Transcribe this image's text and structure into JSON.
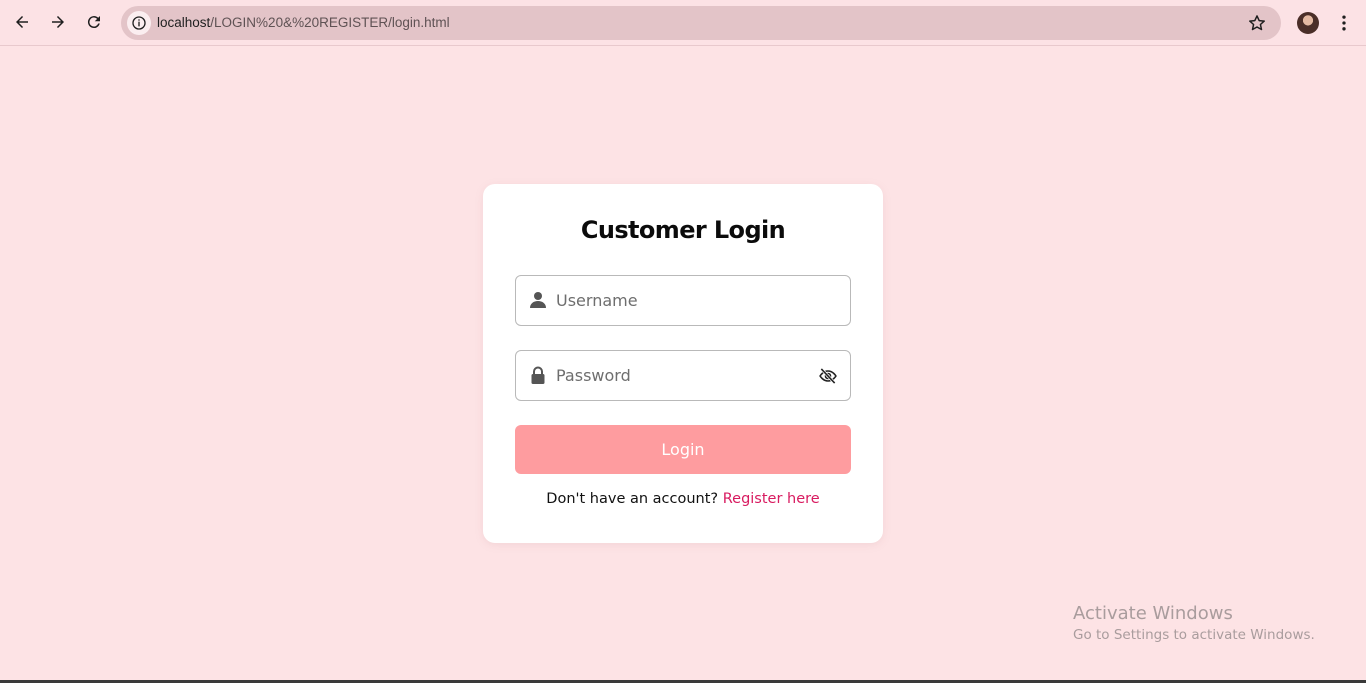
{
  "browser": {
    "url_host": "localhost",
    "url_path": "/LOGIN%20&%20REGISTER/login.html",
    "icons": [
      "back-arrow-icon",
      "forward-arrow-icon",
      "reload-icon",
      "info-icon",
      "star-icon",
      "avatar",
      "more-vert-icon"
    ]
  },
  "login": {
    "title": "Customer Login",
    "username_placeholder": "Username",
    "password_placeholder": "Password",
    "button_label": "Login",
    "register_prompt": "Don't have an account?",
    "register_link": "Register here"
  },
  "watermark": {
    "title": "Activate Windows",
    "subtitle": "Go to Settings to activate Windows."
  },
  "colors": {
    "page_background": "#fde3e5",
    "button": "#fe9c9f",
    "link": "#d81b60",
    "omnibox": "#e3c4c8"
  }
}
